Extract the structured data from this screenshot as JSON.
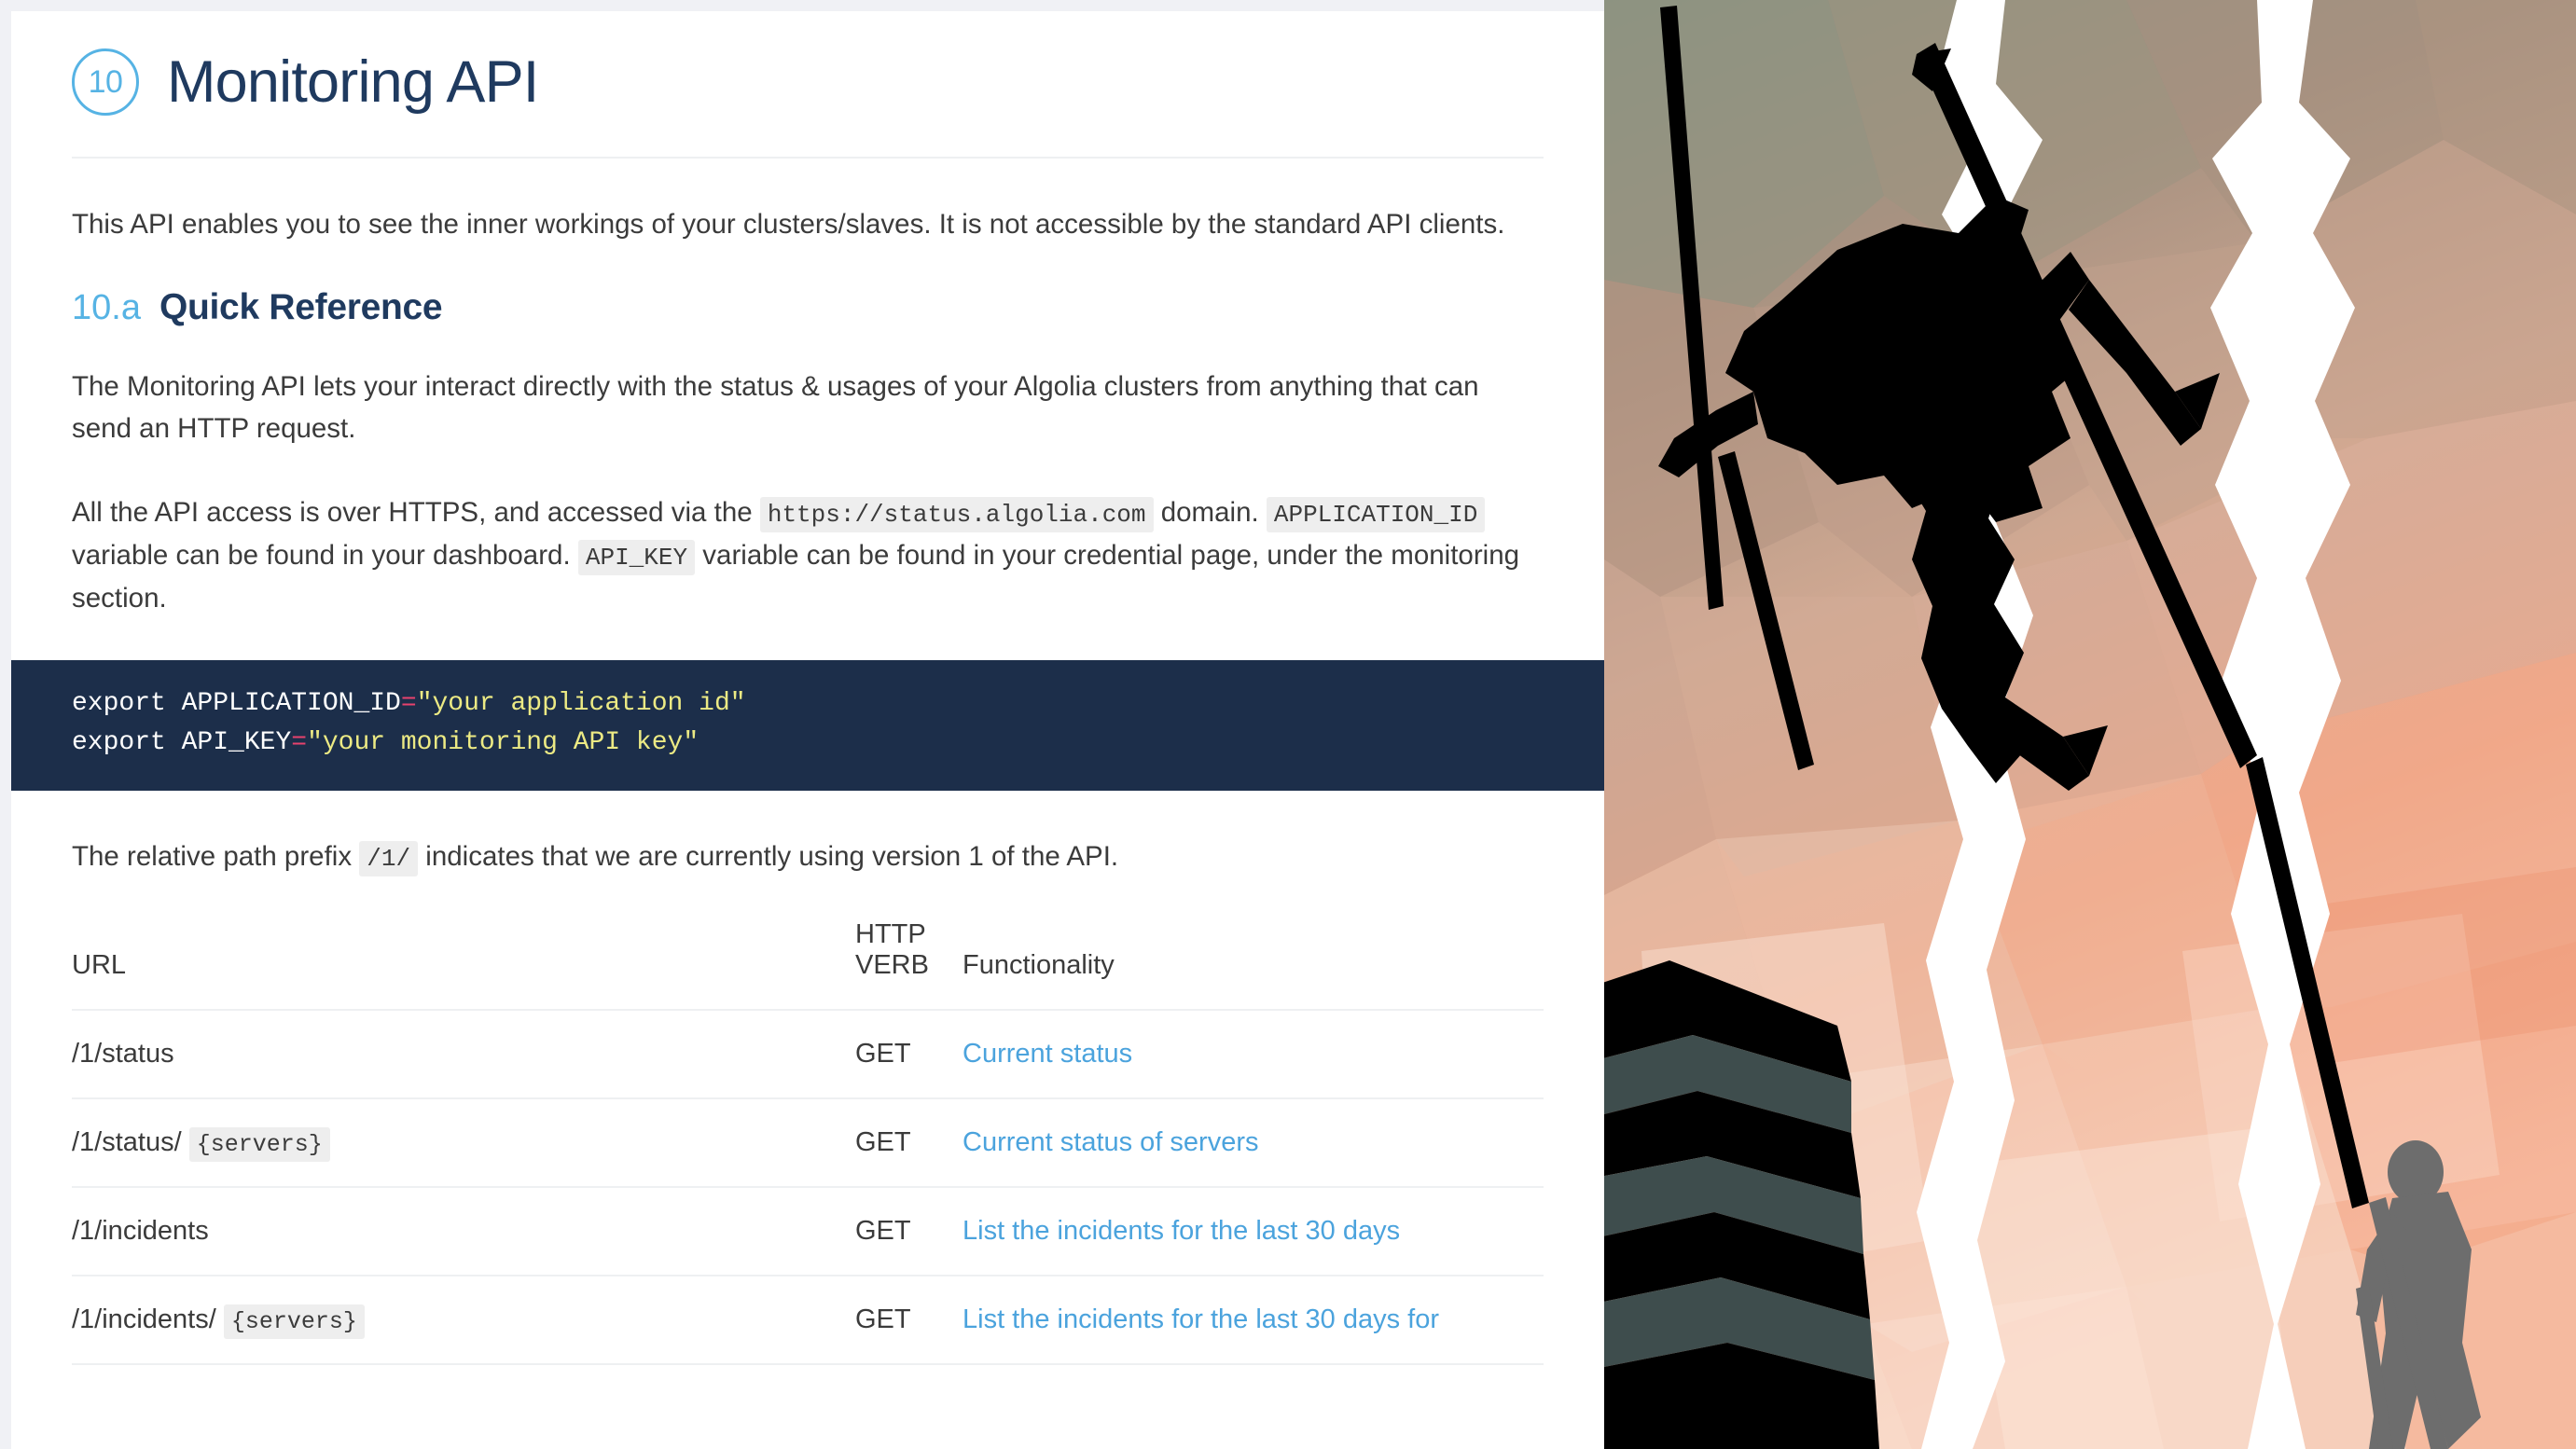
{
  "document": {
    "chapter_number": "10",
    "title": "Monitoring API",
    "intro": "This API enables you to see the inner workings of your clusters/slaves. It is not accessible by the standard API clients.",
    "section": {
      "number": "10.a",
      "title": "Quick Reference",
      "paragraph_1": "The Monitoring API lets your interact directly with the status & usages of your Algolia clusters from anything that can send an HTTP request.",
      "paragraph_2_parts": {
        "a": "All the API access is over HTTPS, and accessed via the",
        "code_domain": "https://status.algolia.com",
        "b": "domain.",
        "code_app_id": "APPLICATION_ID",
        "c": "variable can be found in your dashboard.",
        "code_api_key": "API_KEY",
        "d": "variable can be found in your credential page, under the monitoring section."
      },
      "paragraph_3_parts": {
        "a": "The relative path prefix",
        "code_prefix": "/1/",
        "b": "indicates that we are currently using version 1 of the API."
      }
    },
    "code_block": {
      "line1": {
        "keyword": "export ",
        "variable": "APPLICATION_ID",
        "operator": "=",
        "value": "\"your application id\""
      },
      "line2": {
        "keyword": "export ",
        "variable": "API_KEY",
        "operator": "=",
        "value": "\"your monitoring API key\""
      }
    },
    "table": {
      "headers": {
        "url": "URL",
        "verb_line1": "HTTP",
        "verb_line2": "VERB",
        "functionality": "Functionality"
      },
      "rows": [
        {
          "url_prefix": "/1/status",
          "url_code": "",
          "verb": "GET",
          "functionality": "Current status"
        },
        {
          "url_prefix": "/1/status/ ",
          "url_code": "{servers}",
          "verb": "GET",
          "functionality": "Current status of servers"
        },
        {
          "url_prefix": "/1/incidents",
          "url_code": "",
          "verb": "GET",
          "functionality": "List the incidents for the last 30 days"
        },
        {
          "url_prefix": "/1/incidents/ ",
          "url_code": "{servers}",
          "verb": "GET",
          "functionality": "List the incidents for the last 30 days for"
        }
      ]
    }
  },
  "colors": {
    "accent_blue": "#56b3e4",
    "link_blue": "#4ba3dd",
    "heading_navy": "#1f3a5f",
    "code_bg": "#1c2e4a",
    "code_string": "#ecea84",
    "code_operator": "#e8426d",
    "inline_code_bg": "#eeeeee",
    "body_text": "#3b3b3b",
    "page_bg": "#f0f1f5"
  },
  "illustration": {
    "name": "mountain-climbers-illustration",
    "description": "Flat polygonal illustration of silhouetted ice climbers with axes on a rock face"
  }
}
